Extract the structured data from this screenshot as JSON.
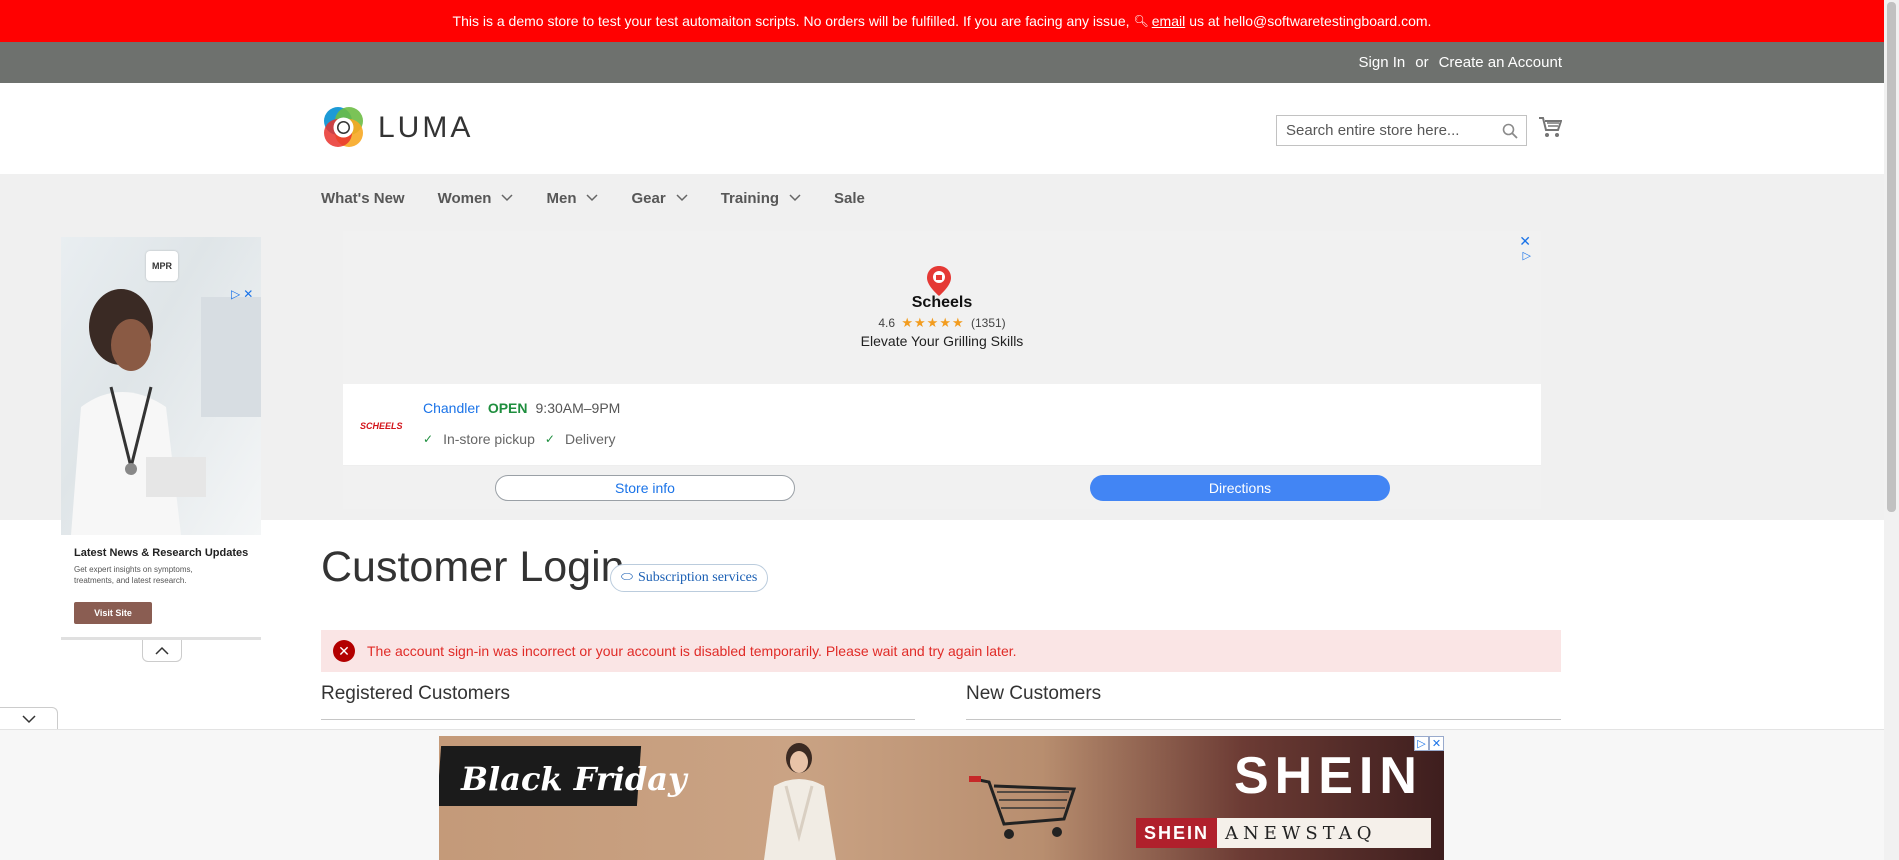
{
  "demo_notice": {
    "text_before": "This is a demo store to test your test automaiton scripts. No orders will be fulfilled. If you are facing any issue,",
    "link": "email",
    "text_after": "us at hello@softwaretestingboard.com."
  },
  "header_links": {
    "sign_in": "Sign In",
    "or": "or",
    "create_account": "Create an Account"
  },
  "logo": {
    "text": "LUMA"
  },
  "search": {
    "placeholder": "Search entire store here..."
  },
  "nav": {
    "items": [
      {
        "label": "What's New",
        "dropdown": false
      },
      {
        "label": "Women",
        "dropdown": true
      },
      {
        "label": "Men",
        "dropdown": true
      },
      {
        "label": "Gear",
        "dropdown": true
      },
      {
        "label": "Training",
        "dropdown": true
      },
      {
        "label": "Sale",
        "dropdown": false
      }
    ]
  },
  "ad_left": {
    "badge": "MPR",
    "headline": "Latest News & Research Updates",
    "description": "Get expert insights on symptoms, treatments, and latest research.",
    "button": "Visit Site"
  },
  "ad_main": {
    "brand": "Scheels",
    "rating": "4.6",
    "stars": "★★★★★",
    "reviews": "(1351)",
    "tagline": "Elevate Your Grilling Skills",
    "store_logo": "SCHEELS",
    "city": "Chandler",
    "status": "OPEN",
    "hours": "9:30AM–9PM",
    "feature_1": "In-store pickup",
    "feature_2": "Delivery",
    "store_info": "Store info",
    "directions": "Directions"
  },
  "page": {
    "title": "Customer Login",
    "subscription_chip": "Subscription services",
    "error": "The account sign-in was incorrect or your account is disabled temporarily. Please wait and try again later.",
    "registered_title": "Registered Customers",
    "new_title": "New Customers"
  },
  "bottom_ad": {
    "headline": "Black Friday",
    "brand": "SHEIN",
    "brand_small": "SHEIN",
    "slogan": "ANEWSTAQ"
  },
  "colors": {
    "demo_bar": "#ff0101",
    "panel_header": "#6e716e",
    "error_bg": "#fae5e5",
    "error_text": "#e02b27",
    "directions_button": "#4285f4"
  }
}
